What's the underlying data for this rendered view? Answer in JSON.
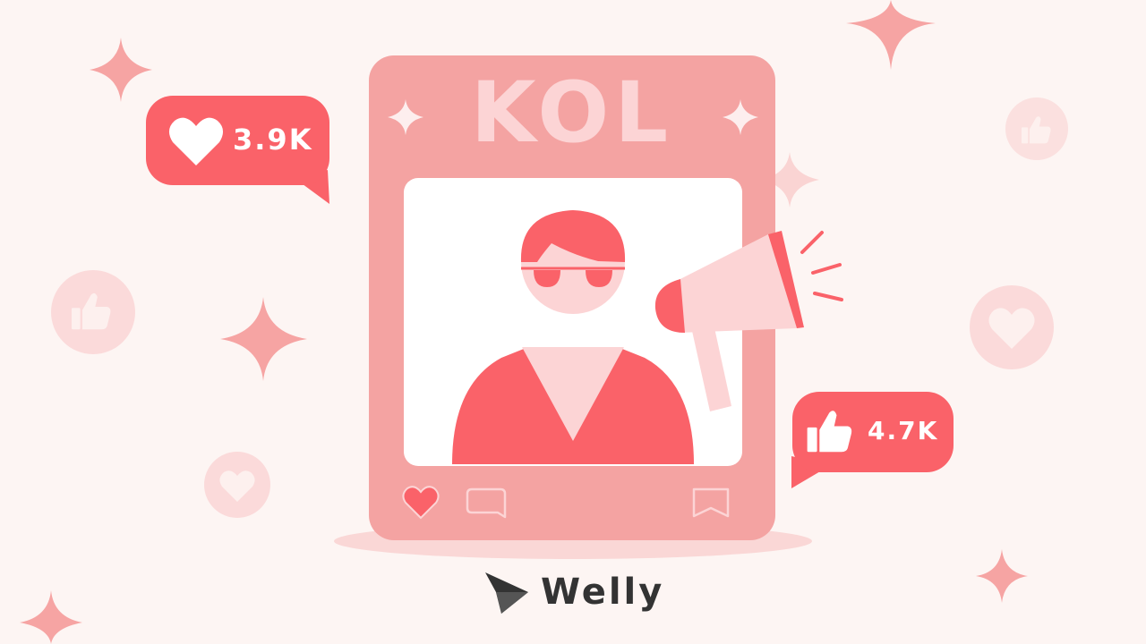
{
  "post": {
    "title": "KOL"
  },
  "bubbles": {
    "likes": "3.9K",
    "thumbs_up": "4.7K"
  },
  "brand": {
    "name": "Welly"
  },
  "colors": {
    "background": "#fdf5f3",
    "frame": "#f4a3a2",
    "accent": "#fa6269",
    "soft_pink": "#fcd4d5",
    "text_dark": "#333333"
  },
  "icons": [
    "heart-icon",
    "thumbs-up-icon",
    "comment-icon",
    "bookmark-icon",
    "megaphone-icon",
    "sparkle-icon",
    "welly-logo-icon"
  ]
}
